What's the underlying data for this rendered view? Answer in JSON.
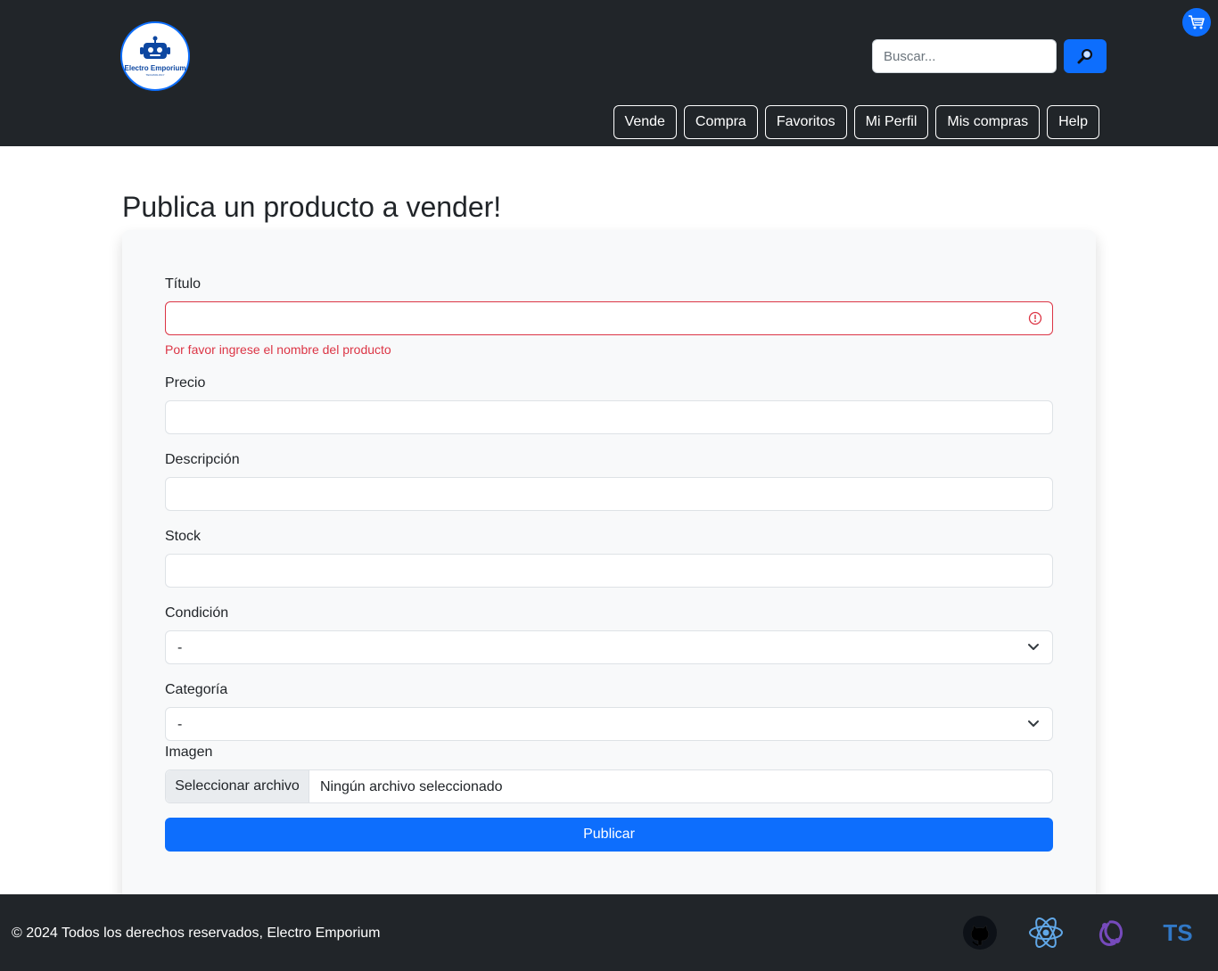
{
  "header": {
    "logo_text": "Electro Emporium",
    "logo_subtext": "TECHNOLOGY",
    "search_placeholder": "Buscar...",
    "search_icon": "magnifier-icon",
    "cart_icon": "cart-icon",
    "nav": [
      "Vende",
      "Compra",
      "Favoritos",
      "Mi Perfil",
      "Mis compras",
      "Help"
    ]
  },
  "page": {
    "title": "Publica un producto a vender!"
  },
  "form": {
    "titulo_label": "Título",
    "titulo_value": "",
    "titulo_error": "Por favor ingrese el nombre del producto",
    "precio_label": "Precio",
    "precio_value": "",
    "descripcion_label": "Descripción",
    "descripcion_value": "",
    "stock_label": "Stock",
    "stock_value": "",
    "condicion_label": "Condición",
    "condicion_value": "-",
    "categoria_label": "Categoría",
    "categoria_value": "-",
    "imagen_label": "Imagen",
    "file_button": "Seleccionar archivo",
    "file_status": "Ningún archivo seleccionado",
    "submit_label": "Publicar"
  },
  "footer": {
    "copyright": "© 2024 Todos los derechos reservados, Electro Emporium",
    "tech_icons": [
      "github-icon",
      "react-icon",
      "redux-icon",
      "typescript-icon"
    ],
    "ts_text": "TS"
  },
  "colors": {
    "header_bg": "#212529",
    "primary": "#0d6efd",
    "danger": "#dc3545",
    "card_bg": "#f8f9fa"
  }
}
